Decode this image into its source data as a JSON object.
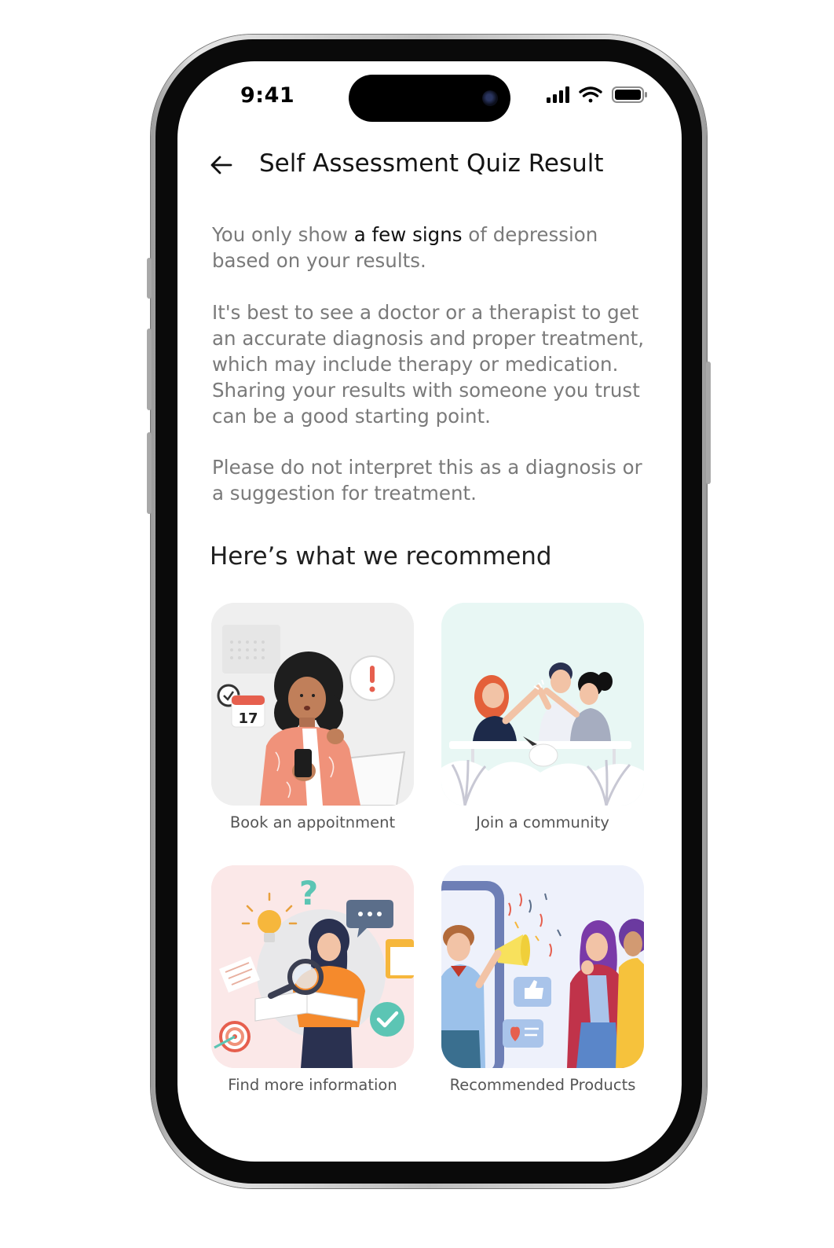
{
  "status_bar": {
    "time": "9:41"
  },
  "header": {
    "title": "Self Assessment Quiz Result"
  },
  "result": {
    "p1_part1": "You only show ",
    "p1_emphasis": "a few signs",
    "p1_part2": " of depression based on your results.",
    "p2": "It's best to see a doctor or a therapist to get an accurate diagnosis and proper treatment, which may include therapy or medication. Sharing your results with someone you trust can be a good starting point.",
    "p3": "Please do not interpret this as a diagnosis or a suggestion for treatment."
  },
  "recommend": {
    "title": "Here’s what we recommend",
    "calendar_day": "17",
    "items": [
      {
        "label": "Book an appoitnment",
        "icon": "appointment-illustration",
        "bg": "#f0f0f0"
      },
      {
        "label": "Join a community",
        "icon": "community-illustration",
        "bg": "#e9f7f4"
      },
      {
        "label": "Find more information",
        "icon": "information-illustration",
        "bg": "#fbe9e9"
      },
      {
        "label": "Recommended Products",
        "icon": "products-illustration",
        "bg": "#eef1fb"
      }
    ]
  }
}
